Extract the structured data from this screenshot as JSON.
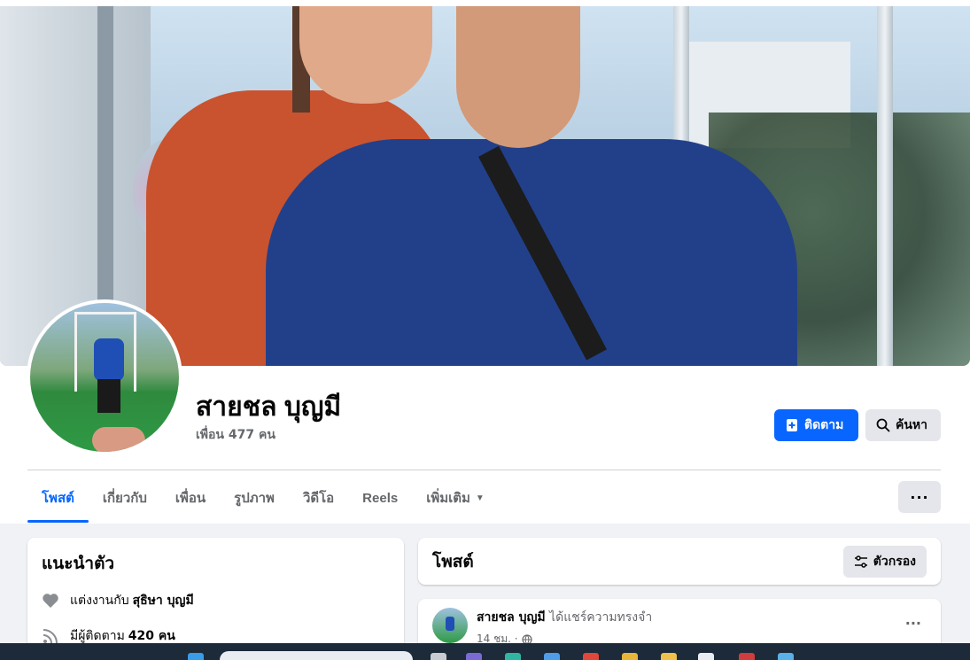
{
  "profile": {
    "name": "สายชล บุญมี",
    "friends": "เพื่อน 477 คน"
  },
  "actions": {
    "follow_label": "ติดตาม",
    "search_label": "ค้นหา"
  },
  "tabs": [
    {
      "label": "โพสต์",
      "active": true
    },
    {
      "label": "เกี่ยวกับ"
    },
    {
      "label": "เพื่อน"
    },
    {
      "label": "รูปภาพ"
    },
    {
      "label": "วิดีโอ"
    },
    {
      "label": "Reels"
    },
    {
      "label": "เพิ่มเติม"
    }
  ],
  "more_button": "···",
  "intro": {
    "title": "แนะนำตัว",
    "married_prefix": "แต่งงานกับ",
    "married_to": "สุธิษา บุญมี",
    "followers_prefix": "มีผู้ติดตาม",
    "followers_count": "420 คน"
  },
  "posts_header": {
    "title": "โพสต์",
    "filter_label": "ตัวกรอง"
  },
  "post": {
    "author": "สายชล บุญมี",
    "action": "ได้แชร์ความทรงจำ",
    "time": "14 ชม. ·",
    "menu": "···"
  },
  "colors": {
    "accent": "#0866ff",
    "secondary_bg": "#e4e6eb",
    "feed_bg": "#f0f2f5",
    "muted_text": "#65676b"
  }
}
